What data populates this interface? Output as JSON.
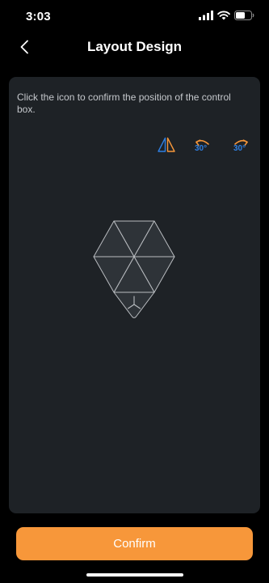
{
  "status_bar": {
    "time": "3:03",
    "icons": [
      "signal-icon",
      "wifi-icon",
      "battery-icon"
    ]
  },
  "nav": {
    "back_icon": "chevron-left-icon",
    "title": "Layout Design"
  },
  "panel": {
    "instruction": "Click the icon to confirm the position of the control box.",
    "tools": [
      {
        "icon": "mirror-flip-icon"
      },
      {
        "icon": "rotate-left-icon",
        "label": "30°"
      },
      {
        "icon": "rotate-right-icon",
        "label": "30°"
      }
    ],
    "layout_icon": "hexagon-triangle-layout-icon"
  },
  "footer": {
    "confirm_label": "Confirm"
  },
  "colors": {
    "background": "#000000",
    "panel": "#1e2226",
    "accent_orange": "#f7973a",
    "accent_blue": "#2f7fe0",
    "shape_fill": "#2e3338",
    "shape_stroke": "#b9bcc0"
  }
}
